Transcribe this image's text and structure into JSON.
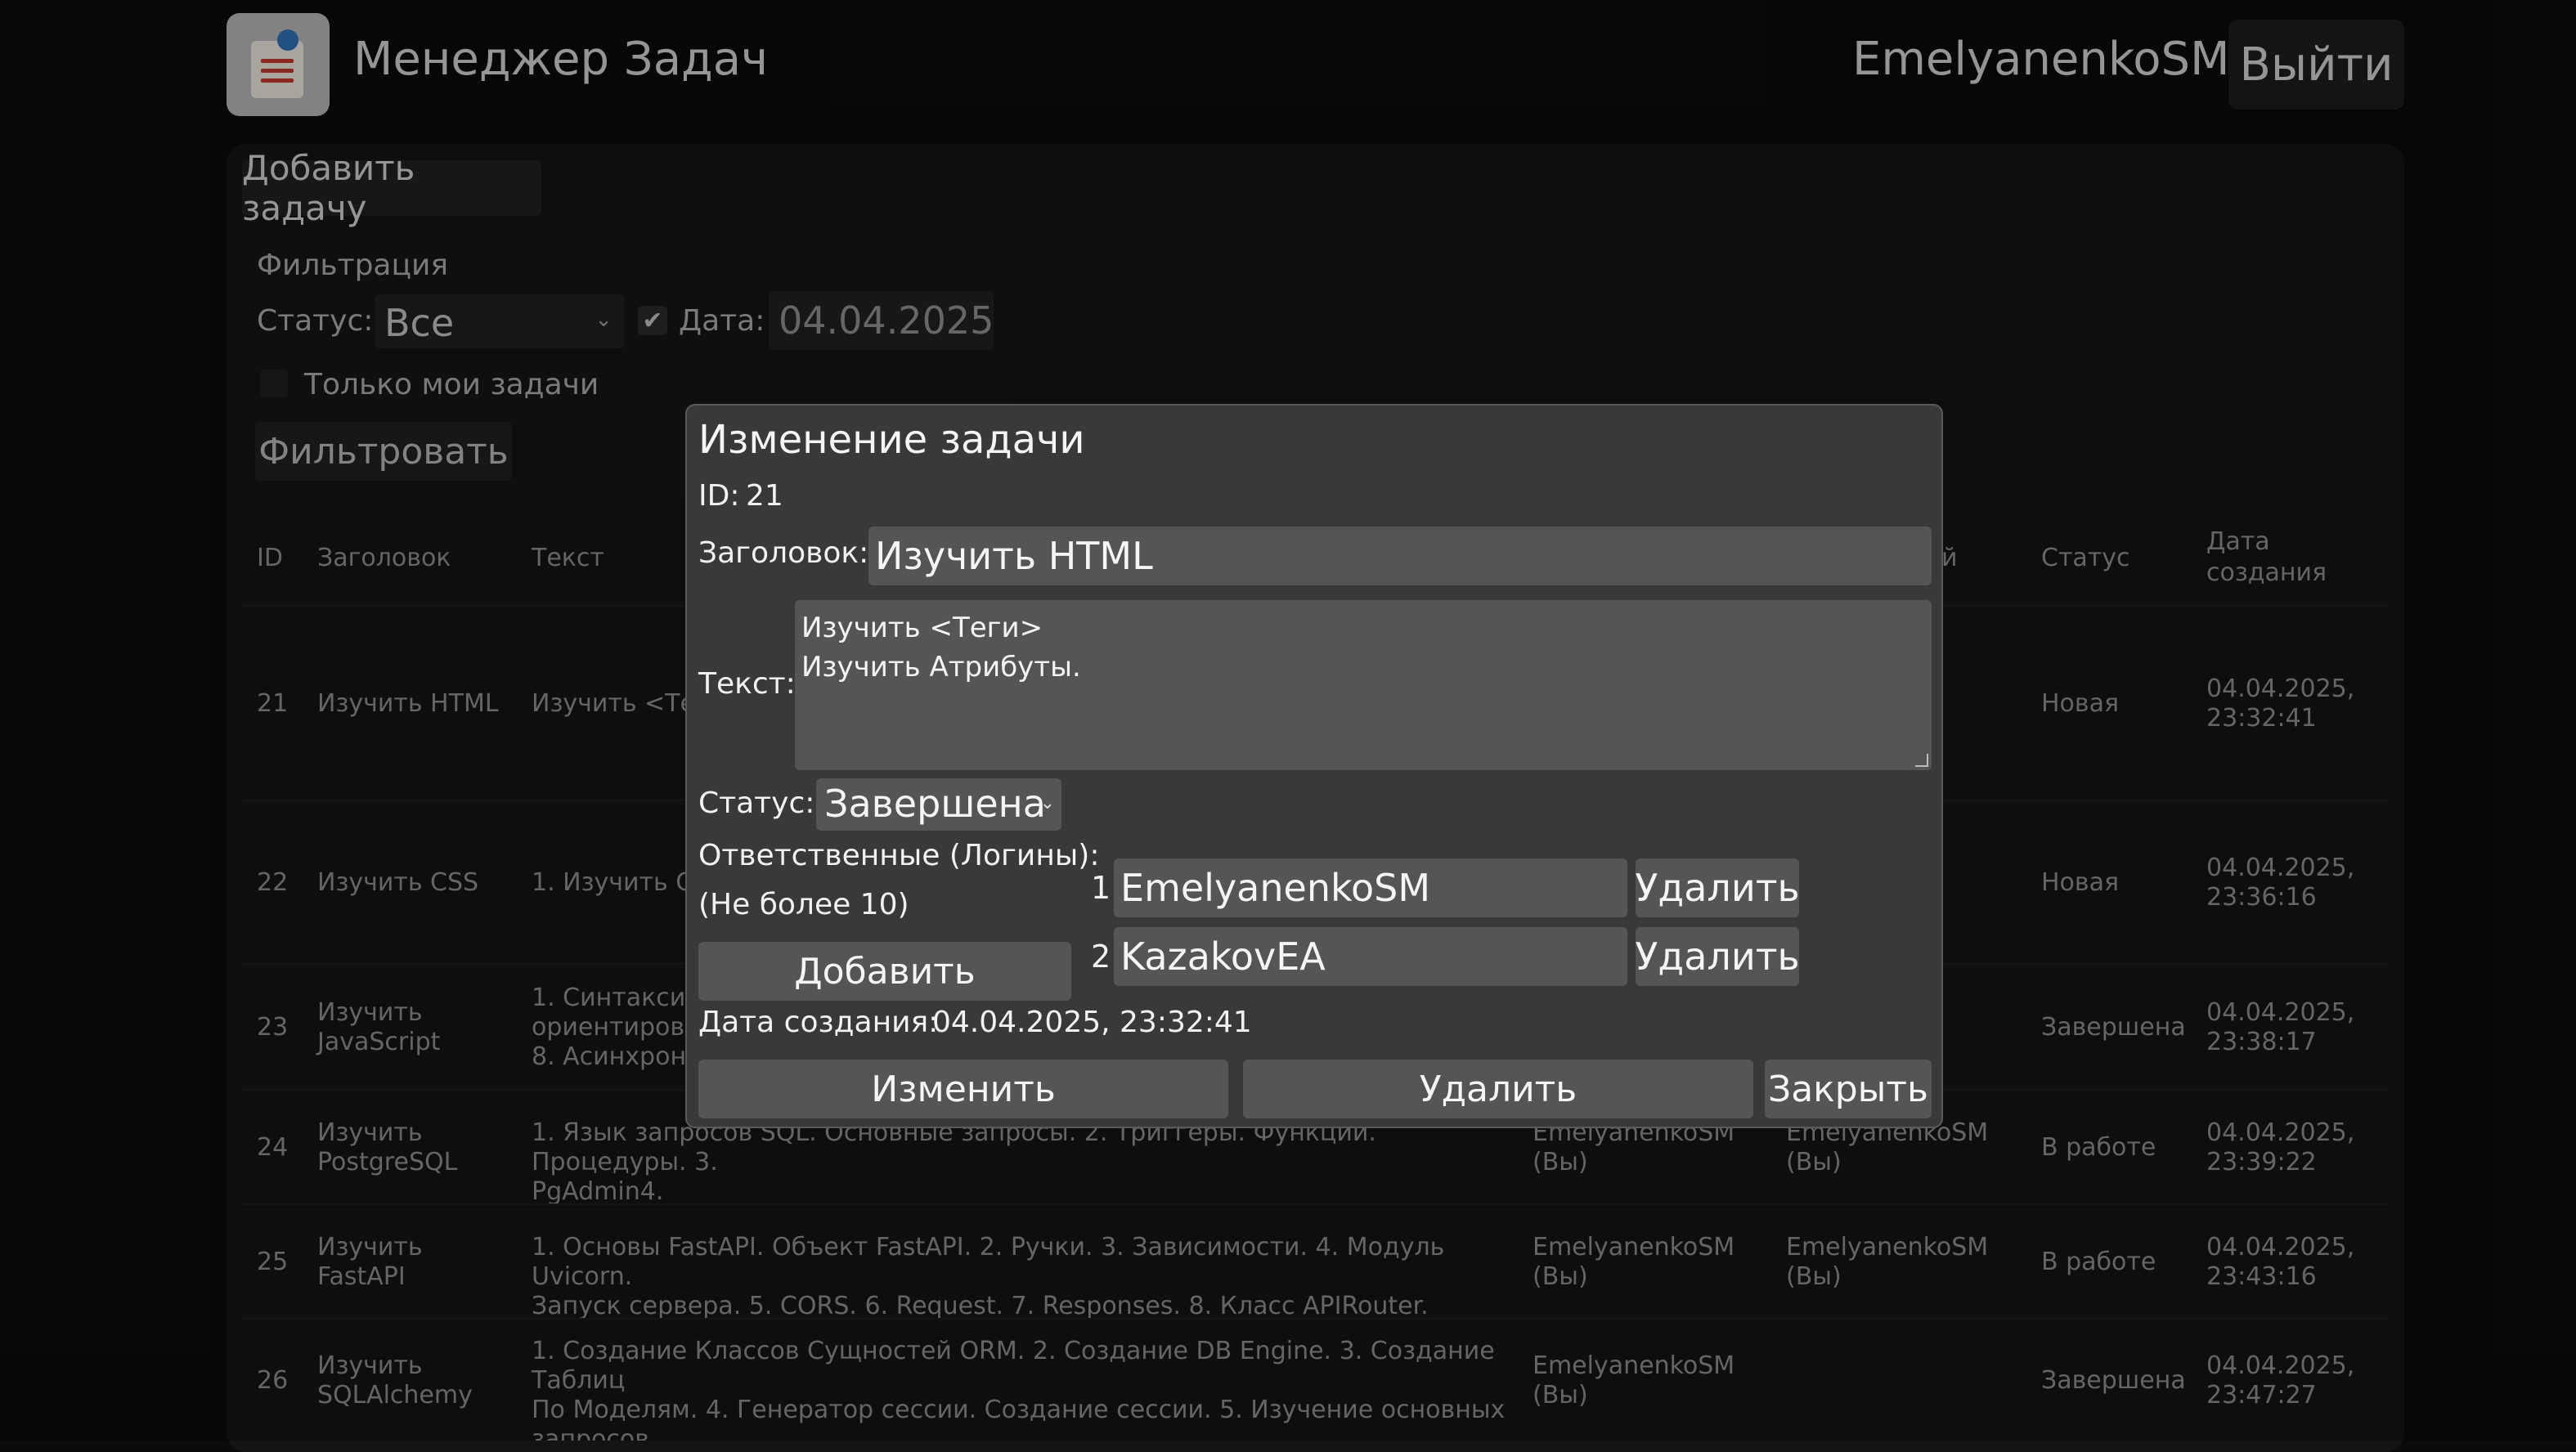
{
  "header": {
    "app_title": "Менеджер Задач",
    "username": "EmelyanenkoSM",
    "logout_label": "Выйти",
    "logo_icon": "task-list-pin-icon"
  },
  "toolbar": {
    "add_task_label": "Добавить задачу"
  },
  "filter": {
    "title": "Фильтрация",
    "status_label": "Статус:",
    "status_value": "Все",
    "date_checked": true,
    "date_label": "Дата:",
    "date_value": "04.04.2025",
    "only_mine_label": "Только мои задачи",
    "only_mine_checked": false,
    "filter_button": "Фильтровать"
  },
  "table": {
    "headers": {
      "id": "ID",
      "title": "Заголовок",
      "text": "Текст",
      "responsible_suffix": "й",
      "status": "Статус",
      "created_line1": "Дата",
      "created_line2": "создания"
    },
    "rows": [
      {
        "id": "21",
        "title": [
          "Изучить HTML"
        ],
        "text": [
          "Изучить <Теги>"
        ],
        "author": [],
        "responsible": [
          "SM"
        ],
        "status": "Новая",
        "created": [
          "04.04.2025,",
          "23:32:41"
        ]
      },
      {
        "id": "22",
        "title": [
          "Изучить CSS"
        ],
        "text": [
          "1. Изучить Се"
        ],
        "author": [],
        "responsible": [],
        "status": "Новая",
        "created": [
          "04.04.2025,",
          "23:36:16"
        ]
      },
      {
        "id": "23",
        "title": [
          "Изучить",
          "JavaScript"
        ],
        "text": [
          "1. Синтаксис",
          "ориентирова",
          "8. Асинхронн"
        ],
        "author": [],
        "responsible": [
          "SM"
        ],
        "status": "Завершена",
        "created": [
          "04.04.2025,",
          "23:38:17"
        ]
      },
      {
        "id": "24",
        "title": [
          "Изучить",
          "PostgreSQL"
        ],
        "text": [
          "1. Язык запросов SQL. Основные запросы. 2. Триггеры. Функции. Процедуры. 3.",
          "PgAdmin4."
        ],
        "author": [
          "EmelyanenkoSM",
          "(Вы)"
        ],
        "responsible": [
          "EmelyanenkoSM",
          "(Вы)"
        ],
        "status": "В работе",
        "created": [
          "04.04.2025,",
          "23:39:22"
        ]
      },
      {
        "id": "25",
        "title": [
          "Изучить",
          "FastAPI"
        ],
        "text": [
          "1. Основы FastAPI. Объект FastAPI. 2. Ручки. 3. Зависимости. 4. Модуль Uvicorn.",
          "Запуск сервера. 5. CORS. 6. Request. 7. Responses. 8. Класс APIRouter."
        ],
        "author": [
          "EmelyanenkoSM",
          "(Вы)"
        ],
        "responsible": [
          "EmelyanenkoSM",
          "(Вы)"
        ],
        "status": "В работе",
        "created": [
          "04.04.2025,",
          "23:43:16"
        ]
      },
      {
        "id": "26",
        "title": [
          "Изучить",
          "SQLAlchemy"
        ],
        "text": [
          "1. Создание Классов Сущностей ORM. 2. Создание DB Engine. 3. Создание Таблиц",
          "По Моделям. 4. Генератор сессии. Создание сессии. 5. Изучение основных",
          "запросов."
        ],
        "author": [
          "EmelyanenkoSM",
          "(Вы)"
        ],
        "responsible": [],
        "status": "Завершена",
        "created": [
          "04.04.2025,",
          "23:47:27"
        ]
      }
    ]
  },
  "modal": {
    "title": "Изменение задачи",
    "id_label": "ID:",
    "id_value": "21",
    "heading_label": "Заголовок:",
    "heading_value": "Изучить HTML",
    "text_label": "Текст:",
    "text_lines": [
      "Изучить <Теги>",
      "Изучить Атрибуты."
    ],
    "status_label": "Статус:",
    "status_value": "Завершена",
    "responsibles_label": "Ответственные (Логины):",
    "responsibles_hint": "(Не более 10)",
    "add_button": "Добавить",
    "responsibles": [
      {
        "num": "1.",
        "login": "EmelyanenkoSM",
        "remove": "Удалить"
      },
      {
        "num": "2.",
        "login": "KazakovEA",
        "remove": "Удалить"
      }
    ],
    "created_label": "Дата создания:",
    "created_value": "04.04.2025, 23:32:41",
    "edit_button": "Изменить",
    "delete_button": "Удалить",
    "close_button": "Закрыть"
  }
}
